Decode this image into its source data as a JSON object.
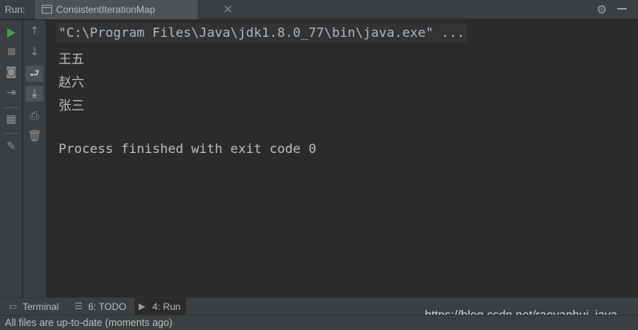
{
  "run_panel": {
    "label": "Run:",
    "tab_title": "ConsistentIterationMap",
    "tab_close": "×",
    "gear_icon": "settings-icon"
  },
  "left_toolbar": {
    "icons": [
      "rerun-icon",
      "stop-icon",
      "camera-icon",
      "exit-icon",
      "layout-icon",
      "pin-icon"
    ]
  },
  "right_toolbar": {
    "up_glyph": "↑",
    "down_glyph": "↓",
    "icons": [
      "up-arrow-icon",
      "down-arrow-icon",
      "soft-wrap-icon",
      "scroll-to-end-icon",
      "print-icon",
      "trash-icon"
    ]
  },
  "console": {
    "command": "\"C:\\Program Files\\Java\\jdk1.8.0_77\\bin\\java.exe\" ...",
    "output_lines": [
      "王五",
      "赵六",
      "张三"
    ],
    "exit_message": "Process finished with exit code 0"
  },
  "tool_windows": [
    {
      "label": "Terminal",
      "icon": "terminal-icon",
      "glyph": "▭"
    },
    {
      "label": "6: TODO",
      "icon": "todo-list-icon",
      "glyph": "☰"
    },
    {
      "label": "4: Run",
      "icon": "run-icon",
      "glyph": "▶"
    }
  ],
  "watermark": "https://blog.csdn.net/raoyanhui_java",
  "status_bar": {
    "message": "All files are up-to-date (moments ago)"
  }
}
